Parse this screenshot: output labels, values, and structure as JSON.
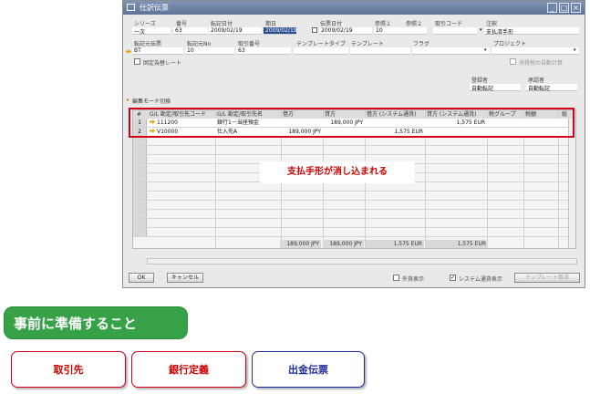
{
  "window": {
    "title": "仕訳伝票",
    "min": "_",
    "max": "□",
    "close": "×"
  },
  "header": {
    "series": {
      "label": "シリーズ",
      "value": "一次"
    },
    "number": {
      "label": "番号",
      "value": "63"
    },
    "posting_date": {
      "label": "転記日付",
      "value": "2009/02/19"
    },
    "due_date": {
      "label": "期日",
      "value": "2009/02/19"
    },
    "document_date": {
      "label": "伝票日付",
      "value": "2009/02/19"
    },
    "ref1": {
      "label": "参照１",
      "value": "10"
    },
    "ref2": {
      "label": "参照２",
      "value": ""
    },
    "trans_code": {
      "label": "取引コード",
      "value": ""
    },
    "remarks": {
      "label": "注釈",
      "value": "支払済手形"
    },
    "origin": {
      "label": "転記元伝票",
      "value": "BT"
    },
    "origin_no": {
      "label": "転記元No",
      "value": "10"
    },
    "trans_no": {
      "label": "取引番号",
      "value": "63"
    },
    "template_type": {
      "label": "テンプレートタイプ",
      "value": ""
    },
    "template": {
      "label": "テンプレート",
      "value": ""
    },
    "indicator": {
      "label": "フラグ",
      "value": ""
    },
    "project": {
      "label": "プロジェクト",
      "value": ""
    },
    "fixed_rate": "固定為替レート",
    "auto_tax": "消費税の自動計算",
    "creator": {
      "label": "登録者",
      "value": "自動転記"
    },
    "approver": {
      "label": "承認者",
      "value": "自動転記"
    }
  },
  "section_label": "編集モード切換",
  "grid": {
    "columns": [
      "#",
      "G/L 勘定/取引先コード",
      "G/L 勘定/取引先名",
      "借方",
      "貸方",
      "借方 (システム通貨)",
      "貸方 (システム通貨)",
      "税グループ",
      "税額",
      "総"
    ],
    "rows": [
      {
        "n": "1",
        "code": "111200",
        "name": "銀行1－当座預金",
        "debit": "",
        "credit": "189,000 JPY",
        "debit_sc": "",
        "credit_sc": "1,575 EUR"
      },
      {
        "n": "2",
        "code": "V10000",
        "name": "仕入先A",
        "debit": "189,000 JPY",
        "credit": "",
        "debit_sc": "1,575 EUR",
        "credit_sc": ""
      }
    ],
    "totals": {
      "debit": "189,000 JPY",
      "credit": "189,000 JPY",
      "debit_sc": "1,575 EUR",
      "credit_sc": "1,575 EUR"
    }
  },
  "footer": {
    "ok": "OK",
    "cancel": "キャンセル",
    "fc_display": "外貨表示",
    "sc_display": "システム通貨表示",
    "template_cancel": "テンプレート取消"
  },
  "callout": "支払手形が消し込まれる",
  "prep_title": "事前に準備すること",
  "prep_buttons": [
    "取引先",
    "銀行定義",
    "出金伝票"
  ],
  "colors": {
    "red_highlight": "#d4001a",
    "green": "#37a147",
    "blue": "#1c2c9c"
  }
}
